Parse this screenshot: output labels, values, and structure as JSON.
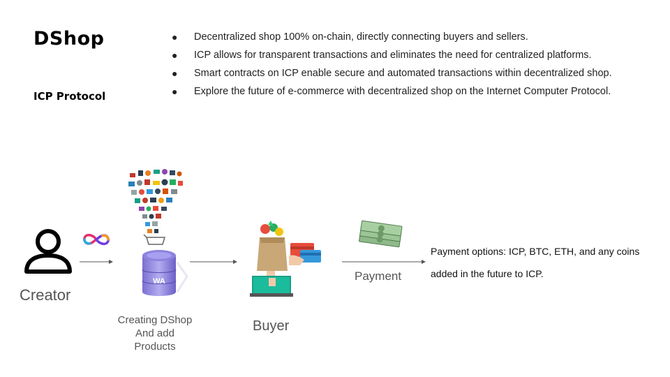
{
  "header": {
    "title": "DShop",
    "subtitle": "ICP Protocol"
  },
  "bullets": [
    "Decentralized shop 100% on-chain, directly connecting buyers and sellers.",
    "ICP allows for transparent transactions and eliminates the need for centralized platforms.",
    "Smart contracts on ICP enable secure and automated transactions within decentralized shop.",
    "Explore the future of e-commerce with decentralized shop on the Internet Computer Protocol."
  ],
  "diagram": {
    "creator_label": "Creator",
    "creating_label": [
      "Creating DShop",
      "And add",
      "Products"
    ],
    "buyer_label": "Buyer",
    "payment_label": "Payment",
    "payment_options": "Payment options: ICP, BTC, ETH, and any coins added in the future to ICP.",
    "database_badge": "WA"
  },
  "icons": [
    "user-icon",
    "infinity-logo-icon",
    "products-funnel-icon",
    "database-icon",
    "shopping-bag-icon",
    "credit-card-hand-icon",
    "cash-icon"
  ],
  "colors": {
    "infinity_pink": "#e3306c",
    "infinity_purple": "#6e3ce3",
    "infinity_orange": "#f59a23",
    "database_purple": "#6c5fc7",
    "arrow_gray": "#555555"
  }
}
